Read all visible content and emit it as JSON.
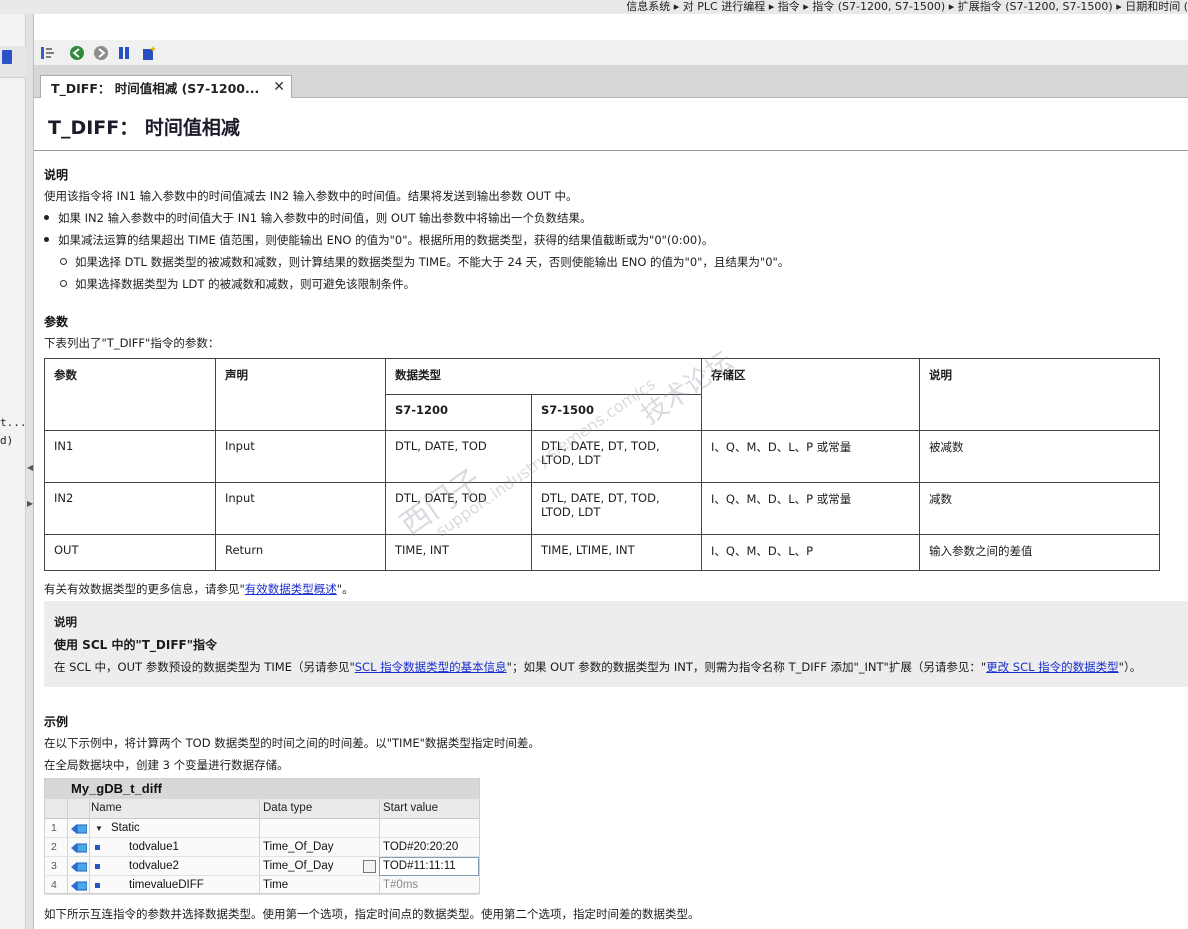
{
  "breadcrumb": "信息系统 ▸ 对 PLC 进行编程 ▸ 指令 ▸ 指令 (S7-1200, S7-1500) ▸ 扩展指令 (S7-1200, S7-1500) ▸ 日期和时间 (",
  "left_panel": {
    "text1": "t...",
    "text2": "d)"
  },
  "tab": {
    "label": "T_DIFF： 时间值相减 (S7-1200...",
    "close": "✕"
  },
  "page_title": "T_DIFF： 时间值相减",
  "desc": {
    "heading": "说明",
    "intro": "使用该指令将 IN1 输入参数中的时间值减去 IN2 输入参数中的时间值。结果将发送到输出参数 OUT 中。",
    "b1": "如果 IN2 输入参数中的时间值大于 IN1 输入参数中的时间值，则 OUT 输出参数中将输出一个负数结果。",
    "b2": "如果减法运算的结果超出 TIME 值范围，则使能输出 ENO 的值为\"0\"。根据所用的数据类型，获得的结果值截断或为\"0\"(0:00)。",
    "s1": "如果选择 DTL 数据类型的被减数和减数，则计算结果的数据类型为 TIME。不能大于 24 天，否则使能输出 ENO 的值为\"0\"，且结果为\"0\"。",
    "s2": "如果选择数据类型为 LDT 的被减数和减数，则可避免该限制条件。"
  },
  "params": {
    "heading": "参数",
    "intro": "下表列出了\"T_DIFF\"指令的参数：",
    "head": {
      "param": "参数",
      "decl": "声明",
      "dtype": "数据类型",
      "s71200": "S7-1200",
      "s71500": "S7-1500",
      "mem": "存储区",
      "desc": "说明"
    },
    "rows": [
      {
        "param": "IN1",
        "decl": "Input",
        "s71200": "DTL, DATE, TOD",
        "s71500a": "DTL, DATE, DT, TOD,",
        "s71500b": "LTOD, LDT",
        "mem": "I、Q、M、D、L、P 或常量",
        "desc": "被减数"
      },
      {
        "param": "IN2",
        "decl": "Input",
        "s71200": "DTL, DATE, TOD",
        "s71500a": "DTL, DATE, DT, TOD,",
        "s71500b": "LTOD, LDT",
        "mem": "I、Q、M、D、L、P 或常量",
        "desc": "减数"
      },
      {
        "param": "OUT",
        "decl": "Return",
        "s71200": "TIME, INT",
        "s71500a": "TIME, LTIME, INT",
        "s71500b": "",
        "mem": "I、Q、M、D、L、P",
        "desc": "输入参数之间的差值"
      }
    ],
    "more_pre": "有关有效数据类型的更多信息，请参见\"",
    "more_link": "有效数据类型概述",
    "more_post": "\"。"
  },
  "note": {
    "label": "说明",
    "title": "使用 SCL 中的\"T_DIFF\"指令",
    "t1": "在 SCL 中，OUT 参数预设的数据类型为 TIME（另请参见\"",
    "link1": "SCL 指令数据类型的基本信息",
    "t2": "\"；如果 OUT 参数的数据类型为 INT，则需为指令名称 T_DIFF 添加\"_INT\"扩展（另请参见：\"",
    "link2": "更改 SCL 指令的数据类型",
    "t3": "\"）。"
  },
  "example": {
    "heading": "示例",
    "p1": "在以下示例中，将计算两个 TOD 数据类型的时间之间的时间差。以\"TIME\"数据类型指定时间差。",
    "p2": "在全局数据块中，创建 3 个变量进行数据存储。",
    "after": "如下所示互连指令的参数并选择数据类型。使用第一个选项，指定时间点的数据类型。使用第二个选项，指定时间差的数据类型。"
  },
  "db": {
    "title": "My_gDB_t_diff",
    "cols": {
      "name": "Name",
      "dtype": "Data type",
      "start": "Start value"
    },
    "rows": [
      {
        "num": "1",
        "name": "Static",
        "dtype": "",
        "start": ""
      },
      {
        "num": "2",
        "name": "todvalue1",
        "dtype": "Time_Of_Day",
        "start": "TOD#20:20:20"
      },
      {
        "num": "3",
        "name": "todvalue2",
        "dtype": "Time_Of_Day",
        "start": "TOD#11:11:11"
      },
      {
        "num": "4",
        "name": "timevalueDIFF",
        "dtype": "Time",
        "start": "T#0ms"
      }
    ]
  },
  "watermark": {
    "w1": "西门子",
    "w2": "support.industry.siemens.com/cs",
    "w3": "技术论坛"
  },
  "colors": {
    "link": "#1a2fcf",
    "note_bg": "#ededed",
    "tab_bg": "#d7d7d7"
  }
}
